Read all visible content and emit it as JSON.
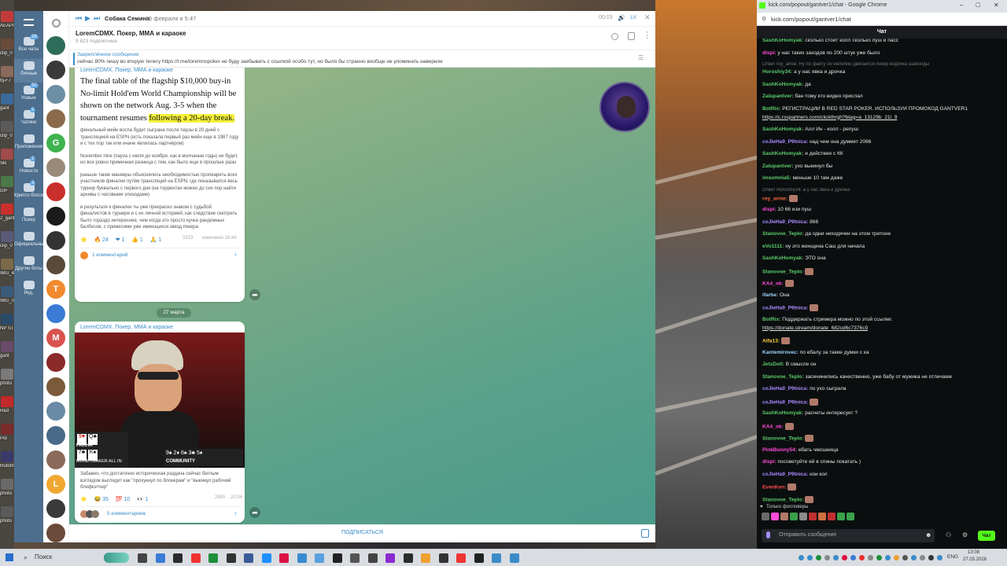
{
  "desktop": {
    "icons": [
      "AEAPI",
      "clip_0",
      "fq-F7",
      "gant",
      "clip_0",
      "Ski",
      "GIF",
      "2_gant",
      "clip_0",
      "IMG_4",
      "IMG_0",
      "NP ST",
      "gant",
      "photo",
      "Red",
      "Pol",
      "Rutom",
      "photo",
      "photo"
    ]
  },
  "telegram": {
    "nav": [
      {
        "label": "Все чаты",
        "badge": "38"
      },
      {
        "label": "Личные",
        "badge": ""
      },
      {
        "label": "Новые",
        "badge": "30"
      },
      {
        "label": "Чатики",
        "badge": "5"
      },
      {
        "label": "Приложения",
        "badge": ""
      },
      {
        "label": "Новости",
        "badge": "2"
      },
      {
        "label": "Крипто блоги",
        "badge": "3"
      },
      {
        "label": "Покер",
        "badge": ""
      },
      {
        "label": "Официальные",
        "badge": ""
      },
      {
        "label": "Другие боты",
        "badge": ""
      },
      {
        "label": "Ред.",
        "badge": ""
      }
    ],
    "chat_avatars": [
      {
        "letter": "",
        "color": "#2f6d5b"
      },
      {
        "letter": "",
        "color": "#3a3a3a"
      },
      {
        "letter": "",
        "color": "#6d8fa6"
      },
      {
        "letter": "",
        "color": "#8a6a4a"
      },
      {
        "letter": "G",
        "color": "#3fb34f"
      },
      {
        "letter": "",
        "color": "#9a8a7a"
      },
      {
        "letter": "",
        "color": "#c9302c"
      },
      {
        "letter": "",
        "color": "#1b1b1b"
      },
      {
        "letter": "",
        "color": "#333333"
      },
      {
        "letter": "",
        "color": "#5a4a3a"
      },
      {
        "letter": "T",
        "color": "#f28a2e"
      },
      {
        "letter": "",
        "color": "#3a7bd5"
      },
      {
        "letter": "M",
        "color": "#d9534f"
      },
      {
        "letter": "",
        "color": "#8a2a2a"
      },
      {
        "letter": "",
        "color": "#7a5a3a"
      },
      {
        "letter": "",
        "color": "#6a8aa6"
      },
      {
        "letter": "",
        "color": "#4a6a8a"
      },
      {
        "letter": "",
        "color": "#8a6a5a"
      },
      {
        "letter": "L",
        "color": "#f0a830"
      },
      {
        "letter": "",
        "color": "#3a3a3a"
      },
      {
        "letter": "",
        "color": "#6a4a3a"
      }
    ],
    "audio": {
      "title": "Собака Семина",
      "date": "15 февраля в 5:47",
      "time": "00:03",
      "speed": "1X"
    },
    "channel": {
      "name": "LoremCDMX. Покер, ММА и караоке",
      "subs": "9 623 подписчика"
    },
    "pinned": {
      "label": "Закреплённое сообщение",
      "text": "сейчас 80% пишу во вторую телегу https://t.me/loremnopoker не буду заебывать с ссылкой особо тут, но было бы странно вообще не упоминать наверное"
    },
    "post1": {
      "sender": "LoremCDMX. Покер, ММА и караоке",
      "headline_a": "The final table of the flagship $10,000 buy-in No-limit Hold'em World Championship will be shown on the network Aug. 3-5 when the tournament resumes ",
      "headline_b": "following a 20-day break.",
      "p1": "финальный мейн воспа будет сыграна после паузы в 20 дней с трансляцией на ESPN (есть показала первый раз мейн еще в 1987 году и с тех пор так или иначе являлась партнёром)",
      "p2": "November nine (пауза с июля до ноября, как в молчаные годы) не будет, но все ровно примечная разница с тем, как было еще в прошлые разы",
      "p3": "раньше такие маневры объяснялись необходимостью пропиарить всех участников финалки путём трансляций на ESPN, где показывался весь турнир буквально с первого дня (на торрентах можно до сих пор найти архивы с часовыми эпизодами)",
      "p4": "в результате к финалке ты уже прекрасно знаком с судьбой финалистов в турнире и с их личной историей, как следствие смотреть было гораздо интереснее, чем когда это просто кучка рандомных балбесов, с примесями уже имеющихся звезд покера",
      "reactions": [
        "⭐",
        "🔥 24",
        "❤ 1",
        "👍 1",
        "🙏 1"
      ],
      "views": "3323",
      "edited": "изменено 18:44",
      "comments": "1 комментарий"
    },
    "date_sep": "27 марта",
    "post2": {
      "sender": "LoremCDMX. Покер, ММА и караоке",
      "img_left_name": "FARHA",
      "img_right_label": "MONEYMAKER ALL IN",
      "img_community": "COMMUNITY",
      "caption": "Забавно, что достаточно историческая раздача сейчас беглым взглядом выглядит как \"прохукнул по блокерам\" и \"выкинул рабочий блефкэтчер\"",
      "reactions": [
        "⭐",
        "😂 35",
        "💯 10",
        "👀 1"
      ],
      "views": "2885",
      "time": "20:04",
      "comments": "5 комментариев"
    },
    "footer_btn": "ПОДПИСАТЬСЯ"
  },
  "chrome": {
    "tab_title": "kick.com/popout/gantver1/chat - Google Chrome",
    "url": "kick.com/popout/gantver1/chat",
    "chat_title": "Чат",
    "messages": [
      {
        "user": "SashKoHomyak",
        "color": "#5ccc6a",
        "text": "сколько стоит колл сколько пуш и пасс"
      },
      {
        "user": "dispi",
        "color": "#ff4bd8",
        "text": "у нас таких заходов по 200 штук уже было"
      },
      {
        "reply": "Ответ roy_arnie: Ну по факту он нелепно двигается покер водочка шаболды"
      },
      {
        "user": "Horoshiy34",
        "color": "#5ccc6a",
        "text": "а у нас явка и дрочка"
      },
      {
        "user": "SashKoHomyak",
        "color": "#5ccc6a",
        "text": "да"
      },
      {
        "user": "Zalupantver",
        "color": "#5ccc6a",
        "text": "бан тому кто видео прислал"
      },
      {
        "user": "BotRix",
        "color": "#5ccc6a",
        "text": "РЕГИСТРАЦИИ В RED STAR POKER. ИСПОЛЬЗУЙ ПРОМОКОД GANTVER1"
      },
      {
        "user": "",
        "color": "#fff",
        "text": "https://c.rsspartners.com/clickthrgh?btag=a_13129b_21l_9"
      },
      {
        "user": "SashKoHomyak",
        "color": "#5ccc6a",
        "text": "Алл Ин - колл - репуш"
      },
      {
        "user": "coJleHa9_P9tnica",
        "color": "#a78bff",
        "text": "над чем она думмет 2066"
      },
      {
        "user": "SashKoHomyak",
        "color": "#5ccc6a",
        "text": "и действие с КК"
      },
      {
        "user": "Zalupantver",
        "color": "#5ccc6a",
        "text": "ухо выкинул бы"
      },
      {
        "user": "imsomnia5",
        "color": "#5ccc6a",
        "text": "меньше 10 там даже"
      },
      {
        "reply": "Ответ Horoshiy34: а у нас явка и дрочка"
      },
      {
        "user": "roy_arnie",
        "color": "#ff6a3a",
        "text": ""
      },
      {
        "user": "dispi",
        "color": "#ff4bd8",
        "text": "10 66 изи пуш"
      },
      {
        "user": "coJleHa9_P9tnica",
        "color": "#a78bff",
        "text": "866"
      },
      {
        "user": "Stanovoe_Teplo",
        "color": "#5ccc6a",
        "text": "да одни неходячки на этом тритоне"
      },
      {
        "user": "eVo1111",
        "color": "#5ccc6a",
        "text": "ну это женщина Саш для начала"
      },
      {
        "user": "SashKoHomyak",
        "color": "#5ccc6a",
        "text": "ЭТО она"
      },
      {
        "user": "Stanovoe_Teplo",
        "color": "#5ccc6a",
        "text": ""
      },
      {
        "user": "KA4_ok",
        "color": "#ff4bd8",
        "text": ""
      },
      {
        "user": "ifarbe",
        "color": "#9ad4ff",
        "text": "Она"
      },
      {
        "user": "coJleHa9_P9tnica",
        "color": "#a78bff",
        "text": ""
      },
      {
        "user": "BotRix",
        "color": "#5ccc6a",
        "text": "Поддержать стримера можно по этой ссылке:"
      },
      {
        "user": "",
        "color": "#fff",
        "text": "https://donate.stream/donate_682cd6c7376c9"
      },
      {
        "user": "Alfa13",
        "color": "#ffd23a",
        "text": ""
      },
      {
        "user": "Kantemirovec",
        "color": "#9ad4ff",
        "text": "по ебалу за такие думки с ка"
      },
      {
        "user": "JetsDoll",
        "color": "#5ccc6a",
        "text": "В смысле он"
      },
      {
        "user": "Stanovoe_Teplo",
        "color": "#5ccc6a",
        "text": "засечинились качественно, уже бабу от мужика не отличаем"
      },
      {
        "user": "coJleHa9_P9tnica",
        "color": "#a78bff",
        "text": "по ухо сыграла"
      },
      {
        "user": "coJleHa9_P9tnica",
        "color": "#a78bff",
        "text": ""
      },
      {
        "user": "SashKoHomyak",
        "color": "#5ccc6a",
        "text": "расчеты интересует ?"
      },
      {
        "user": "KA4_ok",
        "color": "#ff4bd8",
        "text": ""
      },
      {
        "user": "Stanovoe_Teplo",
        "color": "#5ccc6a",
        "text": ""
      },
      {
        "user": "PinkBunny54",
        "color": "#ff4bd8",
        "text": "ебать чмошница"
      },
      {
        "user": "dispi",
        "color": "#ff4bd8",
        "text": "посоветуйте ей в спины покатать )"
      },
      {
        "user": "coJleHa9_P9tnica",
        "color": "#a78bff",
        "text": "изи кол"
      },
      {
        "user": "EvenKen",
        "color": "#ff4b4b",
        "text": ""
      },
      {
        "user": "Stanovoe_Teplo",
        "color": "#5ccc6a",
        "text": ""
      }
    ],
    "followers_only": "Только фолловеры",
    "input_placeholder": "Отправить сообщение",
    "send_label": "Чат"
  },
  "taskbar": {
    "search": "Поиск",
    "lang": "ENG",
    "time": "13:08",
    "date": "27.03.2026"
  }
}
